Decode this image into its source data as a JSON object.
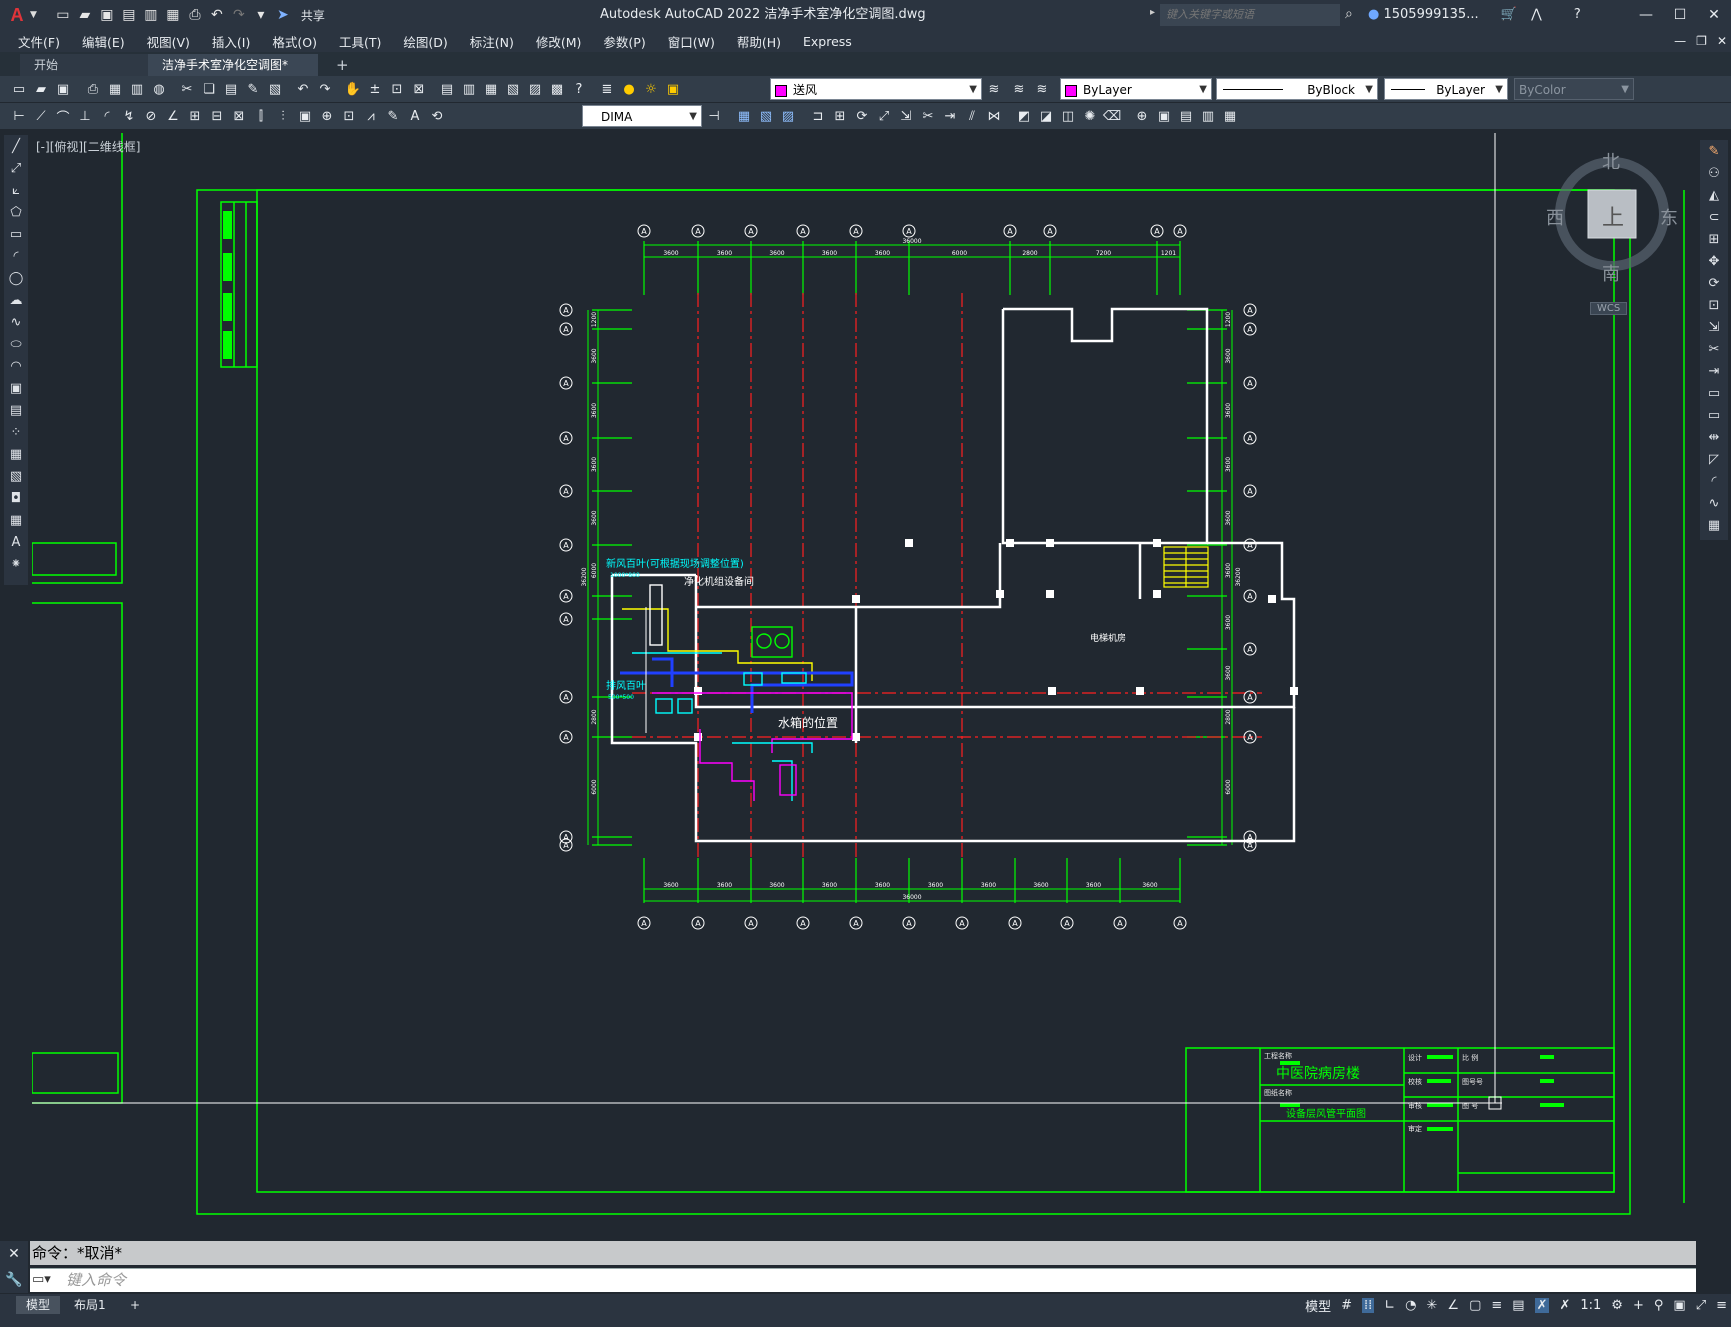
{
  "app": {
    "logo": "A",
    "window_title": "Autodesk AutoCAD 2022    洁净手术室净化空调图.dwg",
    "search_placeholder": "键入关键字或短语",
    "user": "1505999135...",
    "share": "共享"
  },
  "menu": [
    "文件(F)",
    "编辑(E)",
    "视图(V)",
    "插入(I)",
    "格式(O)",
    "工具(T)",
    "绘图(D)",
    "标注(N)",
    "修改(M)",
    "参数(P)",
    "窗口(W)",
    "帮助(H)",
    "Express"
  ],
  "tabs": {
    "start": "开始",
    "active": "洁净手术室净化空调图*",
    "plus": "+"
  },
  "toolbar": {
    "layer": "送风",
    "color": "ByLayer",
    "linetype": "ByBlock",
    "lineweight": "ByLayer",
    "plotstyle": "ByColor",
    "dimstyle": "DIMA",
    "layer_color": "#ff00ff"
  },
  "viewport": {
    "label": "[-][俯视][二维线框]"
  },
  "viewcube": {
    "north": "北",
    "south": "南",
    "east": "东",
    "west": "西",
    "top": "上",
    "wcs": "WCS"
  },
  "drawing": {
    "axis_mark": "A",
    "top_dims": [
      "3600",
      "3600",
      "3600",
      "3600",
      "3600",
      "6000",
      "2800",
      "7200",
      "1201"
    ],
    "top_total": "36000",
    "bottom_dims": [
      "3600",
      "3600",
      "3600",
      "3600",
      "3600",
      "3600",
      "3600",
      "3600",
      "3600",
      "3600"
    ],
    "bottom_total": "36000",
    "left_dims": [
      "1200",
      "3600",
      "3600",
      "3600",
      "3600",
      "6000",
      "2800",
      "6000"
    ],
    "left_total": "36200",
    "right_dims": [
      "1200",
      "3600",
      "3600",
      "3600",
      "3600",
      "3600",
      "3600",
      "3600",
      "2800",
      "6000"
    ],
    "right_total": "36200",
    "label_fresh_air": "新风百叶(可根据现场调整位置)",
    "label_fresh_air_size": "1000*800",
    "label_return_air": "排风百叶",
    "label_return_air_size": "500*500",
    "label_plant_room": "净化机组设备间",
    "label_water_tank": "水箱的位置",
    "label_elevator": "电梯机房"
  },
  "titleblock": {
    "project_label": "工程名称",
    "project_name": "中医院病房楼",
    "drawing_label": "图纸名称",
    "drawing_name": "设备层风管平面图",
    "r1": "设计",
    "r2": "校核",
    "r3": "审核",
    "r4": "审定",
    "s1": "比 例",
    "s2": "图号号",
    "s3": "图 号"
  },
  "command": {
    "history": "命令：*取消*",
    "placeholder": "键入命令"
  },
  "status": {
    "model_tab": "模型",
    "layout_tab": "布局1",
    "add_tab": "+",
    "model_btn": "模型",
    "scale": "1:1"
  }
}
